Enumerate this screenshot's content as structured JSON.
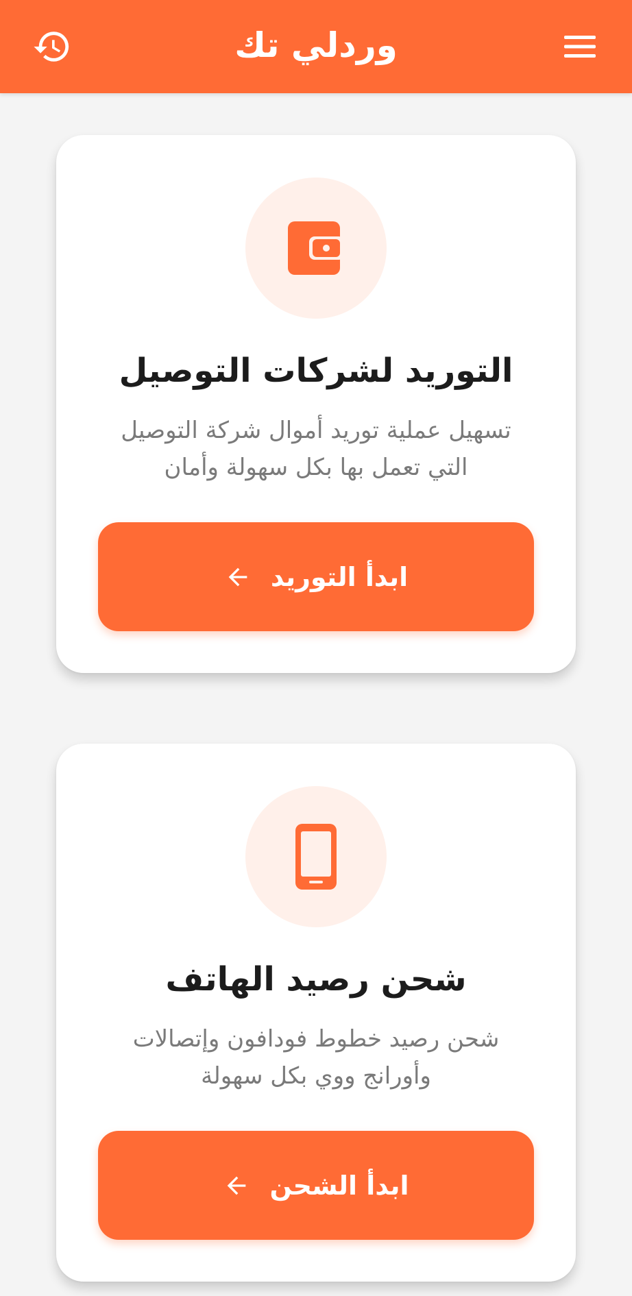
{
  "header": {
    "title": "وردلي تك",
    "left_icon": "history-icon",
    "right_icon": "menu-icon"
  },
  "cards": [
    {
      "icon": "wallet-icon",
      "title": "التوريد لشركات التوصيل",
      "description_line1": "تسهيل عملية توريد أموال شركة التوصيل",
      "description_line2": "التي تعمل بها بكل سهولة وأمان",
      "button_label": "ابدأ التوريد",
      "button_icon": "arrow-left-icon"
    },
    {
      "icon": "smartphone-icon",
      "title": "شحن رصيد الهاتف",
      "description_line1": "شحن رصيد خطوط فودافون وإتصالات",
      "description_line2": "وأورانج ووي بكل سهولة",
      "button_label": "ابدأ الشحن",
      "button_icon": "arrow-left-icon"
    }
  ],
  "colors": {
    "accent": "#ff6b35",
    "icon_bg": "#fff0ea",
    "background": "#f4f4f4",
    "title_text": "#1c1c1c",
    "body_text": "#7a7a7a"
  }
}
